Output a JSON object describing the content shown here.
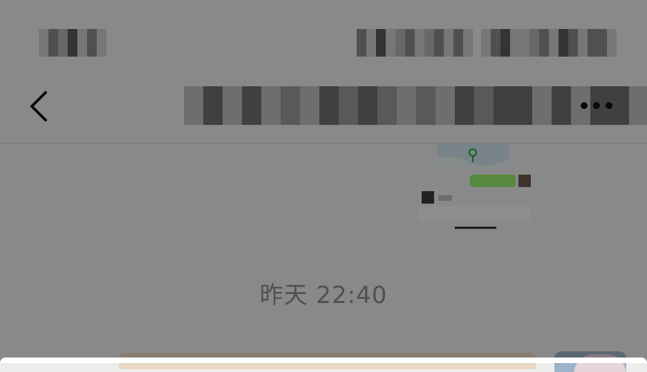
{
  "status_bar": {
    "left_redacted": true,
    "right_redacted": true
  },
  "nav": {
    "back_icon": "chevron-left-icon",
    "title_redacted": true,
    "more_icon": "more-dots-icon"
  },
  "chat": {
    "timestamp": "昨天 22:40"
  },
  "colors": {
    "background": "#ededed",
    "overlay": "rgba(0,0,0,0.42)",
    "timestamp": "#8a8a8a",
    "preview_green": "#95ec69",
    "bubble": "#e8d8c4"
  }
}
